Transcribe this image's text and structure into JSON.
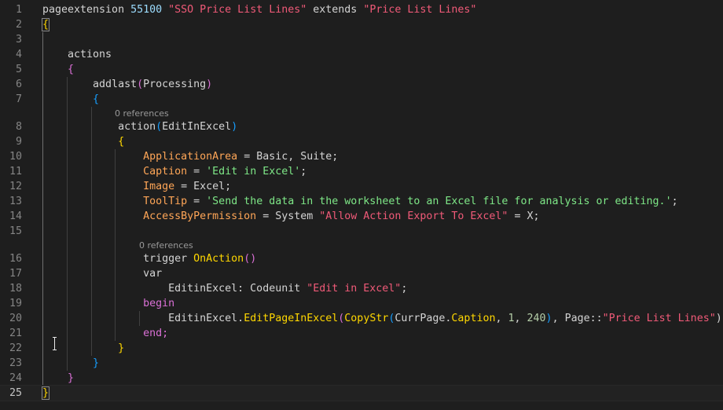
{
  "editor": {
    "line_numbers": [
      "1",
      "2",
      "3",
      "4",
      "5",
      "6",
      "7",
      "8",
      "9",
      "10",
      "11",
      "12",
      "13",
      "14",
      "15",
      "16",
      "17",
      "18",
      "19",
      "20",
      "21",
      "22",
      "23",
      "24",
      "25"
    ],
    "codelens": [
      "0 references",
      "0 references"
    ],
    "lines": [
      [
        {
          "t": "pageextension ",
          "c": "#d4d4d4"
        },
        {
          "t": "55100",
          "c": "#9cdcfe"
        },
        {
          "t": " ",
          "c": "#d4d4d4"
        },
        {
          "t": "\"SSO Price List Lines\"",
          "c": "#f05a78"
        },
        {
          "t": " extends ",
          "c": "#d4d4d4"
        },
        {
          "t": "\"Price List Lines\"",
          "c": "#f05a78"
        }
      ],
      [
        {
          "t": "{",
          "c": "#ffd700"
        }
      ],
      [],
      [
        {
          "t": "    actions",
          "c": "#d4d4d4"
        }
      ],
      [
        {
          "t": "    ",
          "c": "#d4d4d4"
        },
        {
          "t": "{",
          "c": "#da70d6"
        }
      ],
      [
        {
          "t": "        addlast",
          "c": "#d4d4d4"
        },
        {
          "t": "(",
          "c": "#da70d6"
        },
        {
          "t": "Processing",
          "c": "#d4d4d4"
        },
        {
          "t": ")",
          "c": "#da70d6"
        }
      ],
      [
        {
          "t": "        ",
          "c": "#d4d4d4"
        },
        {
          "t": "{",
          "c": "#179fff"
        }
      ],
      [
        {
          "t": "            action",
          "c": "#d4d4d4"
        },
        {
          "t": "(",
          "c": "#179fff"
        },
        {
          "t": "EditInExcel",
          "c": "#d4d4d4"
        },
        {
          "t": ")",
          "c": "#179fff"
        }
      ],
      [
        {
          "t": "            ",
          "c": "#d4d4d4"
        },
        {
          "t": "{",
          "c": "#ffd700"
        }
      ],
      [
        {
          "t": "                ",
          "c": "#d4d4d4"
        },
        {
          "t": "ApplicationArea",
          "c": "#ffa657"
        },
        {
          "t": " = Basic, Suite;",
          "c": "#d4d4d4"
        }
      ],
      [
        {
          "t": "                ",
          "c": "#d4d4d4"
        },
        {
          "t": "Caption",
          "c": "#ffa657"
        },
        {
          "t": " = ",
          "c": "#d4d4d4"
        },
        {
          "t": "'Edit in Excel'",
          "c": "#7ee787"
        },
        {
          "t": ";",
          "c": "#d4d4d4"
        }
      ],
      [
        {
          "t": "                ",
          "c": "#d4d4d4"
        },
        {
          "t": "Image",
          "c": "#ffa657"
        },
        {
          "t": " = Excel;",
          "c": "#d4d4d4"
        }
      ],
      [
        {
          "t": "                ",
          "c": "#d4d4d4"
        },
        {
          "t": "ToolTip",
          "c": "#ffa657"
        },
        {
          "t": " = ",
          "c": "#d4d4d4"
        },
        {
          "t": "'Send the data in the worksheet to an Excel file for analysis or editing.'",
          "c": "#7ee787"
        },
        {
          "t": ";",
          "c": "#d4d4d4"
        }
      ],
      [
        {
          "t": "                ",
          "c": "#d4d4d4"
        },
        {
          "t": "AccessByPermission",
          "c": "#ffa657"
        },
        {
          "t": " = System ",
          "c": "#d4d4d4"
        },
        {
          "t": "\"Allow Action Export To Excel\"",
          "c": "#f05a78"
        },
        {
          "t": " = X;",
          "c": "#d4d4d4"
        }
      ],
      [],
      [
        {
          "t": "                trigger ",
          "c": "#d4d4d4"
        },
        {
          "t": "OnAction",
          "c": "#ffd700"
        },
        {
          "t": "()",
          "c": "#da70d6"
        }
      ],
      [
        {
          "t": "                var",
          "c": "#d4d4d4"
        }
      ],
      [
        {
          "t": "                    EditinExcel: Codeunit ",
          "c": "#d4d4d4"
        },
        {
          "t": "\"Edit in Excel\"",
          "c": "#f05a78"
        },
        {
          "t": ";",
          "c": "#d4d4d4"
        }
      ],
      [
        {
          "t": "                ",
          "c": "#d4d4d4"
        },
        {
          "t": "begin",
          "c": "#da70d6"
        }
      ],
      [
        {
          "t": "                    EditinExcel.",
          "c": "#d4d4d4"
        },
        {
          "t": "EditPageInExcel",
          "c": "#ffd700"
        },
        {
          "t": "(",
          "c": "#da70d6"
        },
        {
          "t": "CopyStr",
          "c": "#ffd700"
        },
        {
          "t": "(",
          "c": "#179fff"
        },
        {
          "t": "CurrPage.",
          "c": "#d4d4d4"
        },
        {
          "t": "Caption",
          "c": "#ffd700"
        },
        {
          "t": ", ",
          "c": "#d4d4d4"
        },
        {
          "t": "1",
          "c": "#b5cea8"
        },
        {
          "t": ", ",
          "c": "#d4d4d4"
        },
        {
          "t": "240",
          "c": "#b5cea8"
        },
        {
          "t": ")",
          "c": "#179fff"
        },
        {
          "t": ", Page::",
          "c": "#d4d4d4"
        },
        {
          "t": "\"Price List Lines\"",
          "c": "#f05a78"
        },
        {
          "t": ");",
          "c": "#d4d4d4"
        }
      ],
      [
        {
          "t": "                ",
          "c": "#d4d4d4"
        },
        {
          "t": "end;",
          "c": "#da70d6"
        }
      ],
      [
        {
          "t": "            ",
          "c": "#d4d4d4"
        },
        {
          "t": "}",
          "c": "#ffd700"
        }
      ],
      [
        {
          "t": "        ",
          "c": "#d4d4d4"
        },
        {
          "t": "}",
          "c": "#179fff"
        }
      ],
      [
        {
          "t": "    ",
          "c": "#d4d4d4"
        },
        {
          "t": "}",
          "c": "#da70d6"
        }
      ],
      [
        {
          "t": "}",
          "c": "#ffd700"
        }
      ]
    ]
  },
  "colors": {
    "background": "#1e1e1e",
    "keyword": "#d4d4d4",
    "property": "#ffa657",
    "string_single": "#7ee787",
    "string_double": "#f05a78",
    "number": "#b5cea8",
    "bracket_gold": "#ffd700",
    "bracket_purple": "#da70d6",
    "bracket_blue": "#179fff"
  }
}
